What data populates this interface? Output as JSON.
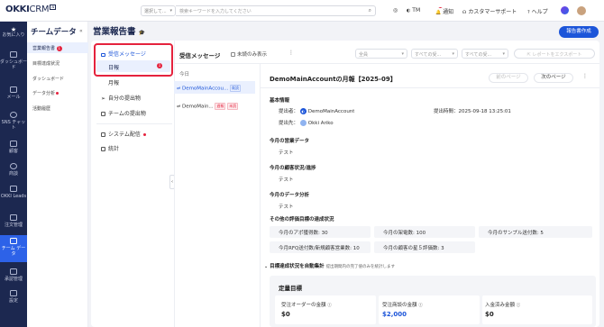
{
  "app": {
    "logo_main": "OKKI",
    "logo_crm": "CRM",
    "logo_badge": "AI"
  },
  "topbar": {
    "select_value": "選択して...",
    "search_placeholder": "検索キーワードを入力してください",
    "team": "TM",
    "notify_label": "通知",
    "notify_count": "1",
    "support": "カスタマーサポート",
    "help": "ヘルプ"
  },
  "leftnav": [
    {
      "label": "お気に入り"
    },
    {
      "label": "ダッシュボード"
    },
    {
      "label": "メール"
    },
    {
      "label": "SNS チャット"
    },
    {
      "label": "顧客"
    },
    {
      "label": "商談"
    },
    {
      "label": "OKKI Leads"
    },
    {
      "label": "注文管理"
    },
    {
      "label": "チーム データ",
      "active": true
    },
    {
      "label": "承認管理"
    },
    {
      "label": "設定"
    }
  ],
  "sidebar": {
    "title": "チームデータ",
    "items": [
      {
        "label": "営業報告書",
        "badge": "1",
        "active": true
      },
      {
        "label": "目標達成状況"
      },
      {
        "label": "ダッシュボード"
      },
      {
        "label": "データ分析",
        "dot": true
      },
      {
        "label": "活動履歴"
      }
    ]
  },
  "page": {
    "title": "営業報告書",
    "create_button": "報告書作成"
  },
  "menu": {
    "received": "受信メッセージ",
    "daily": "日報",
    "daily_badge": "1",
    "monthly": "月報",
    "mine": "自分の提出物",
    "team": "チームの提出物",
    "system": "システム配信",
    "stats": "統計"
  },
  "list": {
    "header": "受信メッセージ",
    "unread_only": "未読のみ表示",
    "group_today": "今日",
    "rows": [
      {
        "name": "DemoMainAccou...",
        "tag": "既読",
        "tag_type": "blue",
        "selected": true
      },
      {
        "name": "DemoMain...",
        "tag": "週報",
        "tag_type": "red",
        "tag2": "未読",
        "tag2_type": "red"
      }
    ]
  },
  "filters": {
    "all": "全員",
    "all_dates": "すべての受...",
    "all_dates2": "すべての受...",
    "export": "レポートをエクスポート"
  },
  "detail": {
    "title": "DemoMainAccountの月報【2025-09】",
    "prev": "前のページ",
    "next": "次のページ",
    "basic_info": "基本情報",
    "submitter_label": "提出者：",
    "submitter": "DemoMainAccount",
    "submit_time_label": "提出時間：",
    "submit_time": "2025-09-18 13:25:01",
    "recipient_label": "提出先：",
    "recipient": "Okki Ariko",
    "sections": [
      {
        "title": "今月の営業データ",
        "value": "テスト"
      },
      {
        "title": "今月の顧客状況/進捗",
        "value": "テスト"
      },
      {
        "title": "今月のデータ分析",
        "value": "テスト"
      }
    ],
    "eval_title": "その他の評価目標の達成状況",
    "eval_items": [
      "今月のアポ獲得数: 30",
      "今月の架電数: 100",
      "今月のサンプル送付数: 5",
      "今月RFQ送付数/新規顧客営業数: 10",
      "今月の顧客の星５評価数: 3"
    ],
    "auto_title": "目標達成状況を自動集計",
    "auto_note": "提出期間内の完了値のみを統計します",
    "quant_title": "定量目標",
    "kpis": [
      {
        "label": "受注オーダーの金額",
        "value": "$0",
        "color": "#222222"
      },
      {
        "label": "受注商談の金額",
        "value": "$2,000",
        "color": "#1c55d9"
      },
      {
        "label": "入金済み金額",
        "value": "$0",
        "color": "#222222"
      }
    ]
  },
  "colors": {
    "primary": "#1c55d9",
    "nav_bg": "#1c2850",
    "alert": "#e5223d"
  }
}
